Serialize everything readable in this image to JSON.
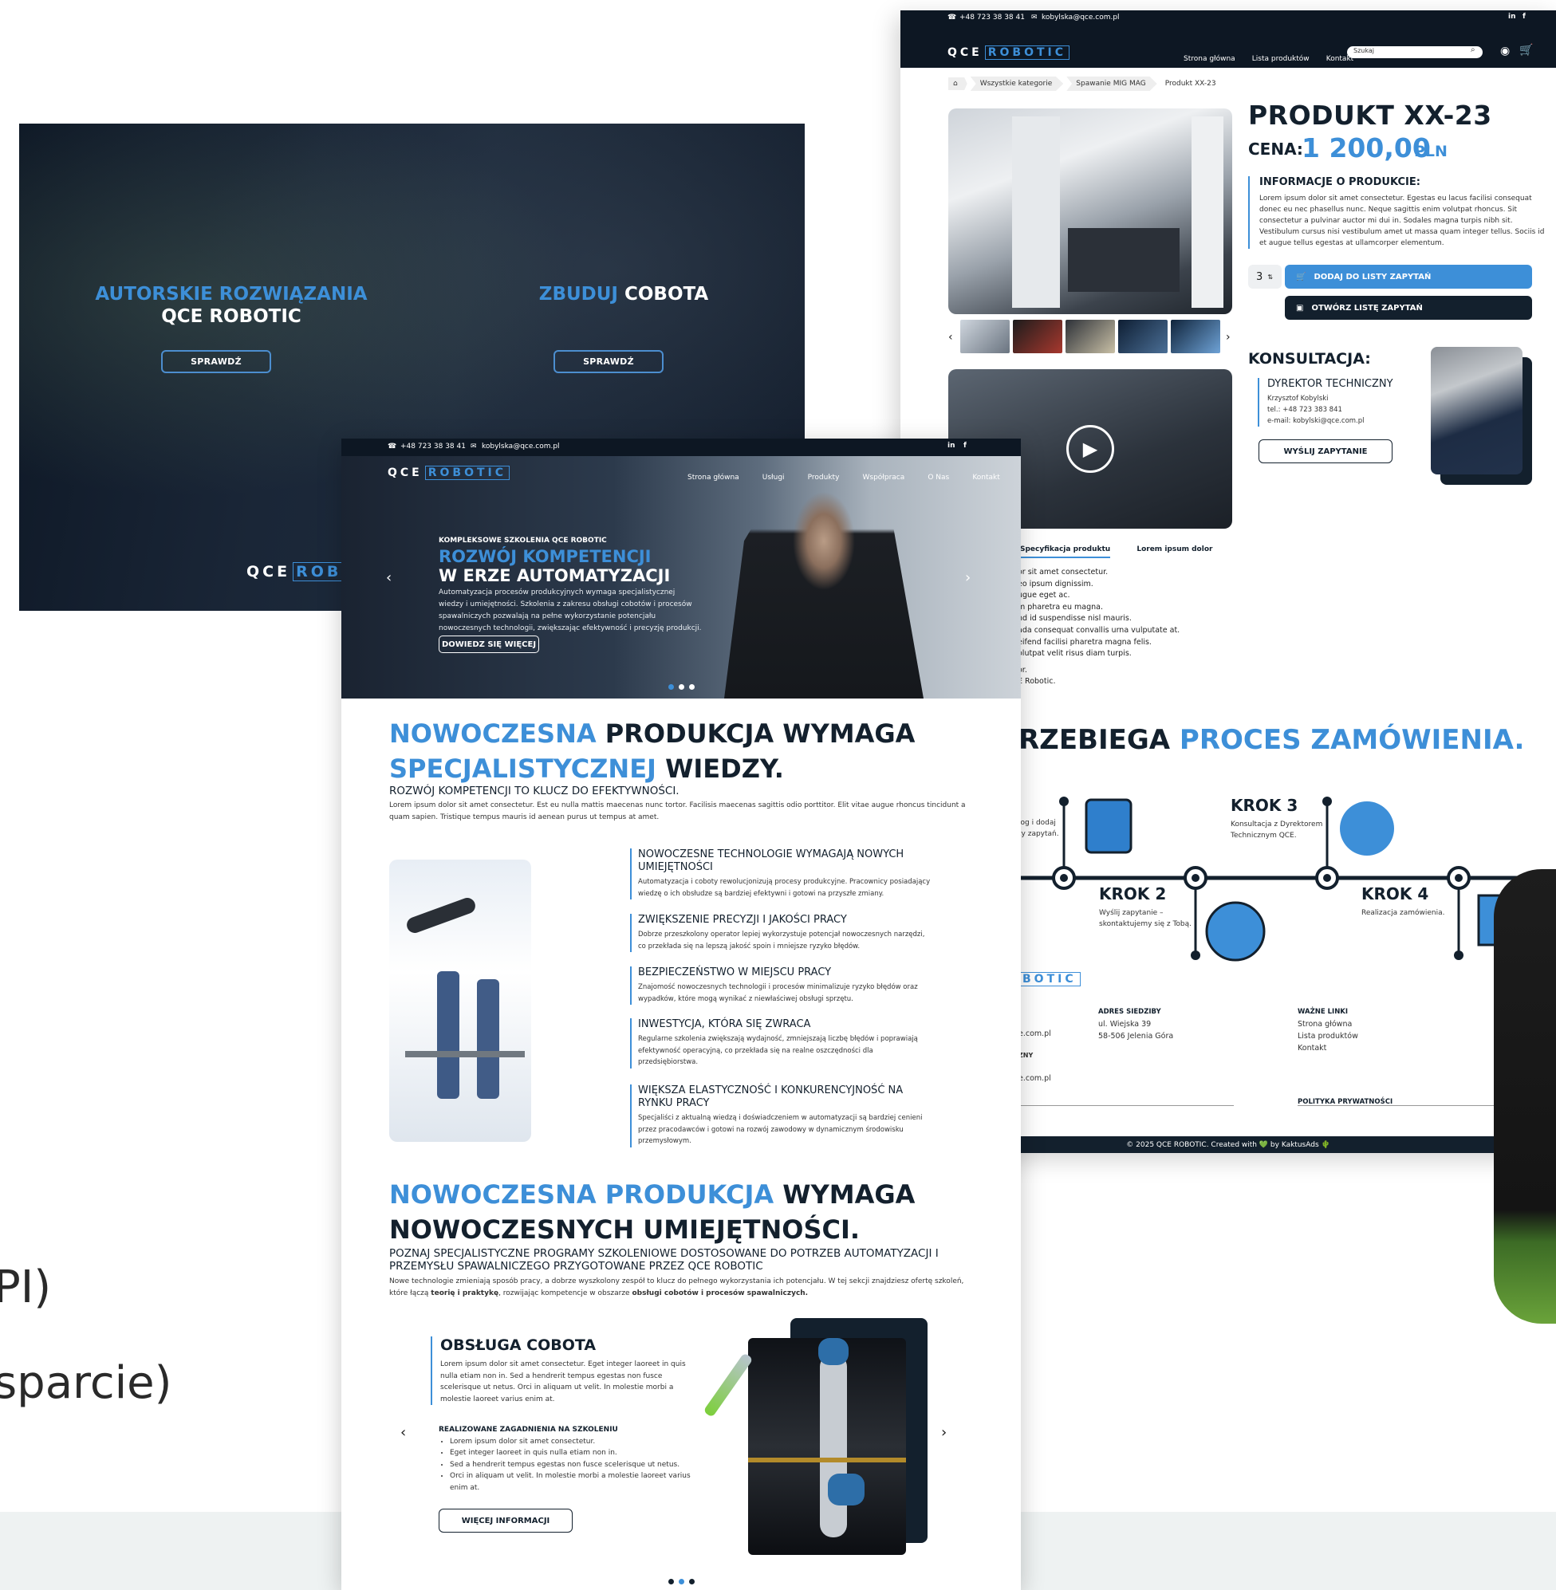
{
  "background_side_text": [
    "PI)",
    "sparcie)"
  ],
  "left_hero": {
    "panel1": {
      "title_blue": "AUTORSKIE ROZWIĄZANIA",
      "title_white": "QCE ROBOTIC",
      "button": "SPRAWDŹ"
    },
    "panel2": {
      "title_blue": "ZBUDUJ",
      "title_white": "COBOTA",
      "button": "SPRAWDŹ"
    },
    "logo_left": "QCE",
    "logo_right": "ROB"
  },
  "product_page": {
    "topbar": {
      "phone": "+48 723 38 38 41",
      "email": "kobylska@qce.com.pl"
    },
    "logo_left": "QCE",
    "logo_right": "ROBOTIC",
    "menu": [
      "Strona główna",
      "Lista produktów",
      "Kontakt"
    ],
    "search_placeholder": "Szukaj",
    "breadcrumbs": [
      "Wszystkie kategorie",
      "Spawanie MIG MAG",
      "Produkt XX-23"
    ],
    "title": "PRODUKT XX-23",
    "price_label": "CENA:",
    "price_value": "1 200,00",
    "price_currency": "PLN",
    "info_heading": "INFORMACJE O PRODUKCIE:",
    "info_text": "Lorem ipsum dolor sit amet consectetur. Egestas eu lacus facilisi consequat donec eu nec phasellus nunc. Neque sagittis enim volutpat rhoncus. Sit consectetur a pulvinar auctor mi dui in. Sodales magna turpis nibh sit. Vestibulum cursus nisi vestibulum amet ut massa quam integer tellus. Sociis id et augue tellus egestas at ullamcorper elementum.",
    "quantity": "3",
    "add_button": "DODAJ DO LISTY ZAPYTAŃ",
    "open_button": "OTWÓRZ LISTĘ ZAPYTAŃ",
    "konsultacja_title": "KONSULTACJA:",
    "director_title": "DYREKTOR TECHNICZNY",
    "director_name": "Krzysztof Kobylski",
    "director_tel": "tel.: +48 723 383 841",
    "director_email": "e-mail: kobylski@qce.com.pl",
    "send_button": "WYŚLIJ ZAPYTANIE",
    "tabs": [
      "Specyfikacja produktu",
      "Lorem ipsum dolor"
    ],
    "spec_lines": [
      "or sit amet consectetur.",
      "eo ipsum dignissim.",
      "ugue eget ac.",
      "m pharetra eu magna.",
      "nd id suspendisse nisl mauris.",
      "ada consequat convallis urna vulputate at.",
      "eifend facilisi pharetra magna felis.",
      "olutpat velit risus diam turpis.",
      "",
      "or.",
      "E Robotic."
    ],
    "process_title_dark": "RZEBIEGA",
    "process_title_blue": "PROCES ZAMÓWIENIA.",
    "step1_desc": [
      "log i dodaj",
      "ty zapytań."
    ],
    "step2_title": "KROK 2",
    "step2_desc": [
      "Wyślij zapytanie –",
      "skontaktujemy się z Tobą."
    ],
    "step3_title": "KROK 3",
    "step3_desc": [
      "Konsultacja z Dyrektorem",
      "Technicznym QCE."
    ],
    "step4_title": "KROK 4",
    "step4_desc": [
      "Realizacja zamówienia."
    ],
    "footer_logo": "BOTIC",
    "footer_left": [
      "e.com.pl",
      "ZNY",
      "e.com.pl"
    ],
    "footer_address_heading": "ADRES SIEDZIBY",
    "footer_address": [
      "ul. Wiejska 39",
      "58-506 Jelenia Góra"
    ],
    "footer_links_heading": "WAŻNE LINKI",
    "footer_links": [
      "Strona główna",
      "Lista produktów",
      "Kontakt"
    ],
    "footer_privacy": "POLITYKA PRYWATNOŚCI",
    "copyright": "© 2025 QCE ROBOTIC. Created with 💚 by KaktusAds 🌵"
  },
  "center_page": {
    "topbar": {
      "phone": "+48 723 38 38 41",
      "email": "kobylska@qce.com.pl"
    },
    "logo_left": "QCE",
    "logo_right": "ROBOTIC",
    "menu": [
      "Strona główna",
      "Usługi",
      "Produkty",
      "Współpraca",
      "O Nas",
      "Kontakt"
    ],
    "hero": {
      "kicker": "KOMPLEKSOWE SZKOLENIA QCE ROBOTIC",
      "title_blue": "ROZWÓJ KOMPETENCJI",
      "title_white": "W ERZE AUTOMATYZACJI",
      "text": "Automatyzacja procesów produkcyjnych wymaga specjalistycznej wiedzy i umiejętności. Szkolenia z zakresu obsługi cobotów i procesów spawalniczych pozwalają na pełne wykorzystanie potencjału nowoczesnych technologii, zwiększając efektywność i precyzję produkcji.",
      "button": "DOWIEDZ SIĘ WIĘCEJ"
    },
    "section1": {
      "h_blue1": "NOWOCZESNA",
      "h_dark1": "PRODUKCJA WYMAGA",
      "h_blue2": "SPECJALISTYCZNEJ",
      "h_dark2": "WIEDZY.",
      "sub": "ROZWÓJ KOMPETENCJI TO KLUCZ DO EFEKTYWNOŚCI.",
      "body": "Lorem ipsum dolor sit amet consectetur. Est eu nulla mattis maecenas nunc tortor. Facilisis maecenas sagittis odio porttitor. Elit vitae augue rhoncus tincidunt a quam sapien. Tristique tempus mauris id aenean purus ut tempus at amet."
    },
    "features": [
      {
        "title": "NOWOCZESNE TECHNOLOGIE WYMAGAJĄ NOWYCH UMIEJĘTNOŚCI",
        "text": "Automatyzacja i coboty rewolucjonizują procesy produkcyjne. Pracownicy posiadający wiedzę o ich obsłudze są bardziej efektywni i gotowi na przyszłe zmiany."
      },
      {
        "title": "ZWIĘKSZENIE PRECYZJI I JAKOŚCI PRACY",
        "text": "Dobrze przeszkolony operator lepiej wykorzystuje potencjał nowoczesnych narzędzi, co przekłada się na lepszą jakość spoin i mniejsze ryzyko błędów."
      },
      {
        "title": "BEZPIECZEŃSTWO W MIEJSCU PRACY",
        "text": "Znajomość nowoczesnych technologii i procesów minimalizuje ryzyko błędów oraz wypadków, które mogą wynikać z niewłaściwej obsługi sprzętu."
      },
      {
        "title": "INWESTYCJA, KTÓRA SIĘ ZWRACA",
        "text": "Regularne szkolenia zwiększają wydajność, zmniejszają liczbę błędów i poprawiają efektywność operacyjną, co przekłada się na realne oszczędności dla przedsiębiorstwa."
      },
      {
        "title": "WIĘKSZA ELASTYCZNOŚĆ I KONKURENCYJNOŚĆ NA RYNKU PRACY",
        "text": "Specjaliści z aktualną wiedzą i doświadczeniem w automatyzacji są bardziej cenieni przez pracodawców i gotowi na rozwój zawodowy w dynamicznym środowisku przemysłowym."
      }
    ],
    "section2": {
      "h_blue": "NOWOCZESNA PRODUKCJA",
      "h_dark1": "WYMAGA",
      "h_dark2": "NOWOCZESNYCH UMIEJĘTNOŚCI.",
      "sub": "POZNAJ SPECJALISTYCZNE PROGRAMY SZKOLENIOWE DOSTOSOWANE DO POTRZEB AUTOMATYZACJI I PRZEMYSŁU SPAWALNICZEGO PRZYGOTOWANE PRZEZ QCE ROBOTIC",
      "body_a": "Nowe technologie zmieniają sposób pracy, a dobrze wyszkolony zespół to klucz do pełnego wykorzystania ich potencjału. W tej sekcji znajdziesz ofertę szkoleń, które łączą",
      "body_bold1": "teorię i praktykę",
      "body_b": ", rozwijając kompetencje w obszarze",
      "body_bold2": "obsługi cobotów i procesów spawalniczych."
    },
    "course": {
      "title": "OBSŁUGA COBOTA",
      "text": "Lorem ipsum dolor sit amet consectetur. Eget integer laoreet in quis nulla etiam non in. Sed a hendrerit tempus egestas non fusce scelerisque ut netus. Orci in aliquam ut velit. In molestie morbi a molestie laoreet varius enim at.",
      "topics_heading": "REALIZOWANE ZAGADNIENIA NA SZKOLENIU",
      "topics": [
        "Lorem ipsum dolor sit amet consectetur.",
        "Eget integer laoreet in quis nulla etiam non in.",
        "Sed a hendrerit tempus egestas non fusce scelerisque ut netus.",
        "Orci in aliquam ut velit. In molestie morbi a molestie laoreet varius enim at."
      ],
      "button": "WIĘCEJ INFORMACJI"
    }
  },
  "colors": {
    "accent": "#3d8fd8",
    "dark": "#13202d",
    "navbar": "#0d1723"
  }
}
